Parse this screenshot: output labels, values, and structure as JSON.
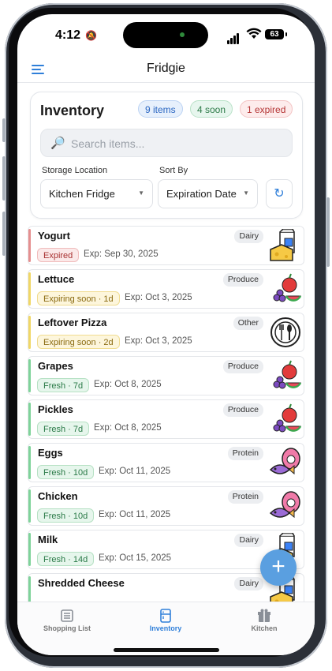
{
  "status_bar": {
    "time": "4:12",
    "battery": "63"
  },
  "app": {
    "title": "Fridgie"
  },
  "inventory": {
    "title": "Inventory",
    "counts": {
      "items": "9 items",
      "soon": "4 soon",
      "expired": "1 expired"
    },
    "search_placeholder": "Search items...",
    "storage_label": "Storage Location",
    "storage_value": "Kitchen Fridge",
    "sort_label": "Sort By",
    "sort_value": "Expiration Date"
  },
  "items": [
    {
      "name": "Yogurt",
      "status": "Expired",
      "status_kind": "expired",
      "exp": "Exp: Sep 30, 2025",
      "category": "Dairy",
      "icon": "dairy-icon"
    },
    {
      "name": "Lettuce",
      "status": "Expiring soon · 1d",
      "status_kind": "soon",
      "exp": "Exp: Oct 3, 2025",
      "category": "Produce",
      "icon": "produce-icon"
    },
    {
      "name": "Leftover Pizza",
      "status": "Expiring soon · 2d",
      "status_kind": "soon",
      "exp": "Exp: Oct 3, 2025",
      "category": "Other",
      "icon": "utensils-icon"
    },
    {
      "name": "Grapes",
      "status": "Fresh · 7d",
      "status_kind": "fresh",
      "exp": "Exp: Oct 8, 2025",
      "category": "Produce",
      "icon": "produce-icon"
    },
    {
      "name": "Pickles",
      "status": "Fresh · 7d",
      "status_kind": "fresh",
      "exp": "Exp: Oct 8, 2025",
      "category": "Produce",
      "icon": "produce-icon"
    },
    {
      "name": "Eggs",
      "status": "Fresh · 10d",
      "status_kind": "fresh",
      "exp": "Exp: Oct 11, 2025",
      "category": "Protein",
      "icon": "protein-icon"
    },
    {
      "name": "Chicken",
      "status": "Fresh · 10d",
      "status_kind": "fresh",
      "exp": "Exp: Oct 11, 2025",
      "category": "Protein",
      "icon": "protein-icon"
    },
    {
      "name": "Milk",
      "status": "Fresh · 14d",
      "status_kind": "fresh",
      "exp": "Exp: Oct 15, 2025",
      "category": "Dairy",
      "icon": "dairy-icon"
    },
    {
      "name": "Shredded Cheese",
      "status": "",
      "status_kind": "fresh",
      "exp": "",
      "category": "Dairy",
      "icon": "dairy-icon"
    }
  ],
  "tabs": [
    {
      "label": "Shopping List",
      "icon": "list-icon",
      "active": false
    },
    {
      "label": "Inventory",
      "icon": "fridge-icon",
      "active": true
    },
    {
      "label": "Kitchen",
      "icon": "gift-icon",
      "active": false
    }
  ],
  "colors": {
    "accent": "#2f7fd9",
    "expired": "#e58f8f",
    "soon": "#f0d766",
    "fresh": "#7fd39a"
  }
}
